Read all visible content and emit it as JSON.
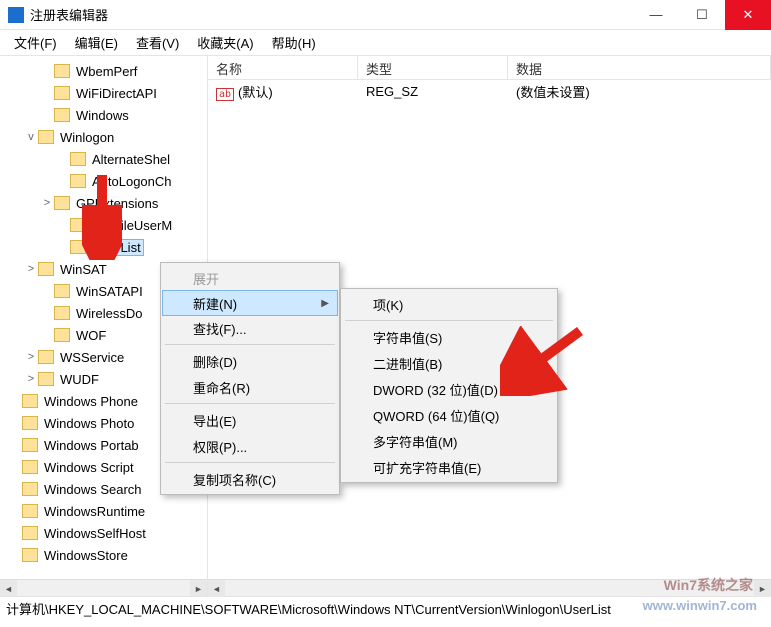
{
  "window": {
    "title": "注册表编辑器"
  },
  "titlebar": {
    "min": "—",
    "max": "☐",
    "close": "✕"
  },
  "menubar": [
    {
      "label": "文件(F)"
    },
    {
      "label": "编辑(E)"
    },
    {
      "label": "查看(V)"
    },
    {
      "label": "收藏夹(A)"
    },
    {
      "label": "帮助(H)"
    }
  ],
  "tree": [
    {
      "indent": 34,
      "exp": "",
      "label": "WbemPerf"
    },
    {
      "indent": 34,
      "exp": "",
      "label": "WiFiDirectAPI"
    },
    {
      "indent": 34,
      "exp": "",
      "label": "Windows"
    },
    {
      "indent": 18,
      "exp": "v",
      "label": "Winlogon"
    },
    {
      "indent": 50,
      "exp": "",
      "label": "AlternateShel"
    },
    {
      "indent": 50,
      "exp": "",
      "label": "AutoLogonCh"
    },
    {
      "indent": 34,
      "exp": ">",
      "label": "GPExtensions"
    },
    {
      "indent": 50,
      "exp": "",
      "label": "VolatileUserM"
    },
    {
      "indent": 50,
      "exp": "",
      "label": "UserList",
      "selected": true
    },
    {
      "indent": 18,
      "exp": ">",
      "label": "WinSAT"
    },
    {
      "indent": 34,
      "exp": "",
      "label": "WinSATAPI"
    },
    {
      "indent": 34,
      "exp": "",
      "label": "WirelessDo"
    },
    {
      "indent": 34,
      "exp": "",
      "label": "WOF"
    },
    {
      "indent": 18,
      "exp": ">",
      "label": "WSService"
    },
    {
      "indent": 18,
      "exp": ">",
      "label": "WUDF"
    },
    {
      "indent": 2,
      "exp": "",
      "label": "Windows Phone"
    },
    {
      "indent": 2,
      "exp": "",
      "label": "Windows Photo"
    },
    {
      "indent": 2,
      "exp": "",
      "label": "Windows Portab"
    },
    {
      "indent": 2,
      "exp": "",
      "label": "Windows Script"
    },
    {
      "indent": 2,
      "exp": "",
      "label": "Windows Search"
    },
    {
      "indent": 2,
      "exp": "",
      "label": "WindowsRuntime"
    },
    {
      "indent": 2,
      "exp": "",
      "label": "WindowsSelfHost"
    },
    {
      "indent": 2,
      "exp": "",
      "label": "WindowsStore"
    }
  ],
  "list": {
    "headers": {
      "name": "名称",
      "type": "类型",
      "data": "数据"
    },
    "cols": {
      "name": 150,
      "type": 150,
      "data": 200
    },
    "rows": [
      {
        "name": "(默认)",
        "type": "REG_SZ",
        "data": "(数值未设置)"
      }
    ]
  },
  "context_menu": {
    "items": [
      {
        "label": "展开",
        "disabled": true
      },
      {
        "label": "新建(N)",
        "submenu": true,
        "highlight": true
      },
      {
        "label": "查找(F)..."
      },
      {
        "sep": true
      },
      {
        "label": "删除(D)"
      },
      {
        "label": "重命名(R)"
      },
      {
        "sep": true
      },
      {
        "label": "导出(E)"
      },
      {
        "label": "权限(P)..."
      },
      {
        "sep": true
      },
      {
        "label": "复制项名称(C)"
      }
    ],
    "submenu": [
      {
        "label": "项(K)"
      },
      {
        "sep": true
      },
      {
        "label": "字符串值(S)"
      },
      {
        "label": "二进制值(B)"
      },
      {
        "label": "DWORD (32 位)值(D)"
      },
      {
        "label": "QWORD (64 位)值(Q)"
      },
      {
        "label": "多字符串值(M)"
      },
      {
        "label": "可扩充字符串值(E)"
      }
    ]
  },
  "statusbar": {
    "part1": "计算机\\HKEY_LOCAL_MACHINE\\SOFTWARE\\Microsoft\\Windows NT\\CurrentVersion\\Winlogon\\UserList",
    "part2": ""
  },
  "watermark": {
    "line1": "Win7系统之家",
    "line2": "www.winwin7.com"
  }
}
